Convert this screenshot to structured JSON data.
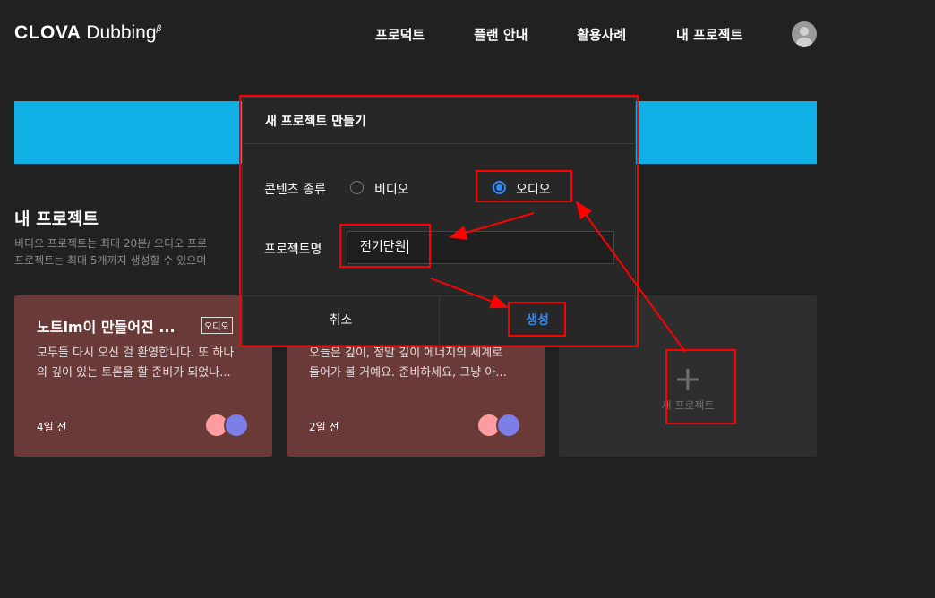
{
  "header": {
    "logo_brand": "CLOVA",
    "logo_sub": "Dubbing",
    "logo_sup": "β",
    "nav": [
      "프로덕트",
      "플랜 안내",
      "활용사례",
      "내 프로젝트"
    ]
  },
  "colors": {
    "banner": "#0fb0e6",
    "accent": "#2f8af5",
    "card": "#6a3a38",
    "annotation": "#ff0000"
  },
  "section": {
    "title": "내 프로젝트",
    "desc_line1": "비디오 프로젝트는 최대 20분/ 오디오 프로",
    "desc_line2": "프로젝트는 최대 5개까지 생성할 수 있으며"
  },
  "cards": [
    {
      "title": "노트lm이 만들어진 ...",
      "badge": "오디오",
      "desc_line1": "모두들 다시 오신 걸 환영합니다. 또 하나",
      "desc_line2": "의 깊이 있는 토론을 할 준비가 되었나...",
      "date": "4일 전"
    },
    {
      "desc_line1": "오늘은 깊이, 정말 깊이 에너지의 세계로",
      "desc_line2": "들어가 볼 거예요. 준비하세요, 그냥 아...",
      "date": "2일 전"
    }
  ],
  "new_project": {
    "plus": "+",
    "label": "새 프로젝트"
  },
  "modal": {
    "title": "새 프로젝트 만들기",
    "content_type_label": "콘텐츠 종류",
    "option_video": "비디오",
    "option_audio": "오디오",
    "selected_option": "오디오",
    "name_label": "프로젝트명",
    "name_value": "전기단원",
    "cancel": "취소",
    "create": "생성"
  }
}
